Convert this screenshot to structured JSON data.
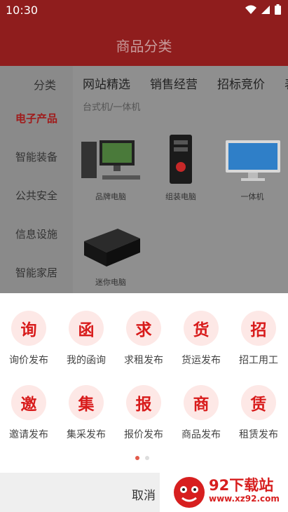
{
  "status_bar": {
    "time": "10:30"
  },
  "header": {
    "title": "商品分类"
  },
  "sidebar": {
    "header": "分类",
    "items": [
      {
        "label": "电子产品"
      },
      {
        "label": "智能装备"
      },
      {
        "label": "公共安全"
      },
      {
        "label": "信息设施"
      },
      {
        "label": "智能家居"
      }
    ]
  },
  "content": {
    "tabs": [
      {
        "label": "网站精选"
      },
      {
        "label": "销售经营"
      },
      {
        "label": "招标竞价"
      },
      {
        "label": "表"
      }
    ],
    "subcategory": "台式机/一体机",
    "products": [
      {
        "label": "品牌电脑",
        "icon": "desktop-pc-icon"
      },
      {
        "label": "组装电脑",
        "icon": "pc-tower-icon"
      },
      {
        "label": "一体机",
        "icon": "all-in-one-icon"
      },
      {
        "label": "迷你电脑",
        "icon": "mini-pc-icon"
      }
    ]
  },
  "sheet": {
    "actions": [
      {
        "char": "询",
        "label": "询价发布"
      },
      {
        "char": "函",
        "label": "我的函询"
      },
      {
        "char": "求",
        "label": "求租发布"
      },
      {
        "char": "货",
        "label": "货运发布"
      },
      {
        "char": "招",
        "label": "招工用工"
      },
      {
        "char": "邀",
        "label": "邀请发布"
      },
      {
        "char": "集",
        "label": "集采发布"
      },
      {
        "char": "报",
        "label": "报价发布"
      },
      {
        "char": "商",
        "label": "商品发布"
      },
      {
        "char": "赁",
        "label": "租赁发布"
      }
    ],
    "cancel": "取消"
  },
  "watermark": {
    "name": "92下载站",
    "url": "www.xz92.com"
  },
  "colors": {
    "accent": "#d81b1b",
    "header_bg": "#8f1d1d",
    "circle_bg": "#fde8e6"
  }
}
